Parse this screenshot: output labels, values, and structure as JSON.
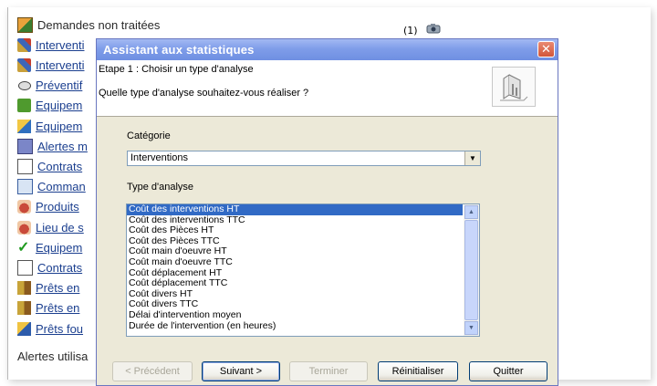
{
  "background_list": {
    "items": [
      {
        "label": "Demandes non traitées",
        "icon": "folder-icon",
        "link": false
      },
      {
        "label": "Interventi",
        "icon": "tool-icon",
        "link": true
      },
      {
        "label": "Interventi",
        "icon": "tool-icon",
        "link": true
      },
      {
        "label": "Préventif",
        "icon": "eye-icon",
        "link": true
      },
      {
        "label": "Equipem",
        "icon": "dollar-icon",
        "link": true
      },
      {
        "label": "Equipem",
        "icon": "box-icon",
        "link": true
      },
      {
        "label": "Alertes m",
        "icon": "screen-icon",
        "link": true
      },
      {
        "label": "Contrats",
        "icon": "document-icon",
        "link": true
      },
      {
        "label": "Comman",
        "icon": "pencil-icon",
        "link": true
      },
      {
        "label": "Produits",
        "icon": "hand-icon",
        "link": true
      },
      {
        "label": "Lieu de s",
        "icon": "hand-icon",
        "link": true
      },
      {
        "label": "Equipem",
        "icon": "check-icon",
        "link": true
      },
      {
        "label": "Contrats",
        "icon": "document-icon",
        "link": true
      },
      {
        "label": "Prêts en",
        "icon": "book-icon",
        "link": true
      },
      {
        "label": "Prêts en",
        "icon": "book-icon",
        "link": true
      },
      {
        "label": "Prêts fou",
        "icon": "pen-icon",
        "link": true
      }
    ],
    "footer_label": "Alertes utilisa",
    "count": "(1)"
  },
  "dialog": {
    "title": "Assistant aux statistiques",
    "close_label": "✕",
    "step_text": "Etape 1 : Choisir un type d'analyse",
    "question": "Quelle type d'analyse souhaitez-vous réaliser ?",
    "category_label": "Catégorie",
    "category_value": "Interventions",
    "type_label": "Type d'analyse",
    "analysis_types": [
      "Coût des interventions HT",
      "Coût des interventions TTC",
      "Coût des Pièces HT",
      "Coût des Pièces TTC",
      "Coût main d'oeuvre HT",
      "Coût main d'oeuvre TTC",
      "Coût déplacement HT",
      "Coût déplacement TTC",
      "Coût divers HT",
      "Coût divers TTC",
      "Délai d'intervention moyen",
      "Durée de l'intervention (en heures)"
    ],
    "selected_index": 0,
    "buttons": {
      "previous": "< Précédent",
      "next": "Suivant >",
      "finish": "Terminer",
      "reset": "Réinitialiser",
      "quit": "Quitter"
    }
  }
}
